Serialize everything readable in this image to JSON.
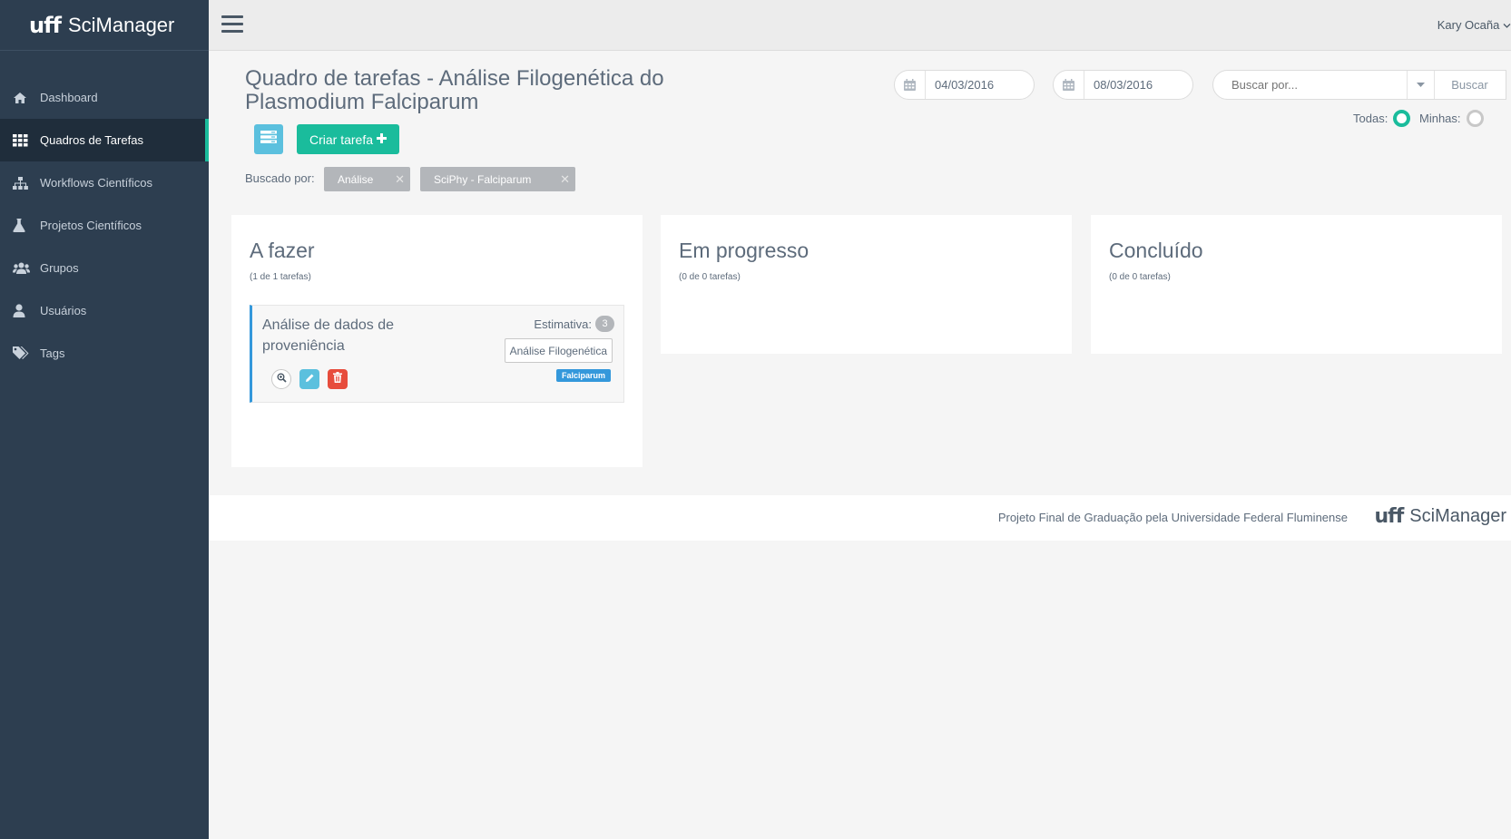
{
  "brand": {
    "logo": "uff",
    "name": "SciManager"
  },
  "sidebar": {
    "items": [
      {
        "label": "Dashboard",
        "icon": "home-icon"
      },
      {
        "label": "Quadros de Tarefas",
        "icon": "grid-icon",
        "active": true
      },
      {
        "label": "Workflows Científicos",
        "icon": "sitemap-icon"
      },
      {
        "label": "Projetos Científicos",
        "icon": "flask-icon"
      },
      {
        "label": "Grupos",
        "icon": "users-icon"
      },
      {
        "label": "Usuários",
        "icon": "user-icon"
      },
      {
        "label": "Tags",
        "icon": "tags-icon"
      }
    ]
  },
  "topbar": {
    "user_name": "Kary Ocaña"
  },
  "page": {
    "title": "Quadro de tarefas - Análise Filogenética do Plasmodium Falciparum",
    "create_label": "Criar tarefa",
    "filters_label": "Buscado por:",
    "chips": [
      "Análise",
      "SciPhy - Falciparum"
    ]
  },
  "search": {
    "date_from": "04/03/2016",
    "date_to": "08/03/2016",
    "placeholder": "Buscar por...",
    "button_label": "Buscar",
    "radio_all_label": "Todas:",
    "radio_mine_label": "Minhas:",
    "selected": "Todas"
  },
  "columns": [
    {
      "title": "A fazer",
      "count": "(1 de 1 tarefas)"
    },
    {
      "title": "Em progresso",
      "count": "(0 de 0 tarefas)"
    },
    {
      "title": "Concluído",
      "count": "(0 de 0 tarefas)"
    }
  ],
  "task": {
    "title": "Análise de dados de proveniência",
    "estimate_label": "Estimativa:",
    "estimate_value": "3",
    "workflow_tag": "Análise Filogenética",
    "project_label": "Falciparum"
  },
  "footer": {
    "text": "Projeto Final de Graduação pela Universidade Federal Fluminense",
    "logo": "uff",
    "name": "SciManager"
  },
  "colors": {
    "sidebar_bg": "#2d3e50",
    "accent": "#1abc9c",
    "info": "#5bc0de",
    "danger": "#e74c3c",
    "primary": "#3498db"
  }
}
